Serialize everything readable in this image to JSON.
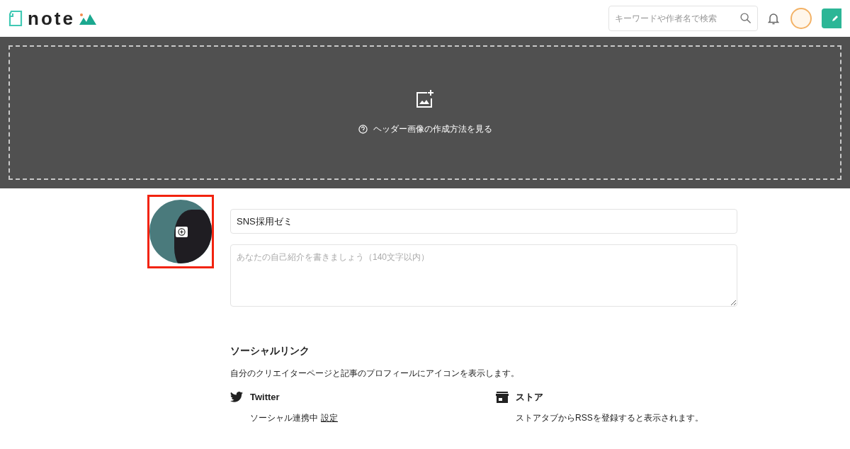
{
  "header": {
    "logo": "note",
    "search": {
      "placeholder": "キーワードや作者名で検索"
    }
  },
  "cover": {
    "help_link": "ヘッダー画像の作成方法を見る"
  },
  "profile": {
    "name": {
      "value": "SNS採用ゼミ"
    },
    "bio": {
      "placeholder": "あなたの自己紹介を書きましょう（140文字以内）"
    }
  },
  "social": {
    "title": "ソーシャルリンク",
    "description": "自分のクリエイターページと記事のプロフィールにアイコンを表示します。",
    "items": [
      {
        "kind": "twitter",
        "name": "Twitter",
        "status": "ソーシャル連携中",
        "link": "設定"
      },
      {
        "kind": "store",
        "name": "ストア",
        "status": "ストアタブからRSSを登録すると表示されます。"
      }
    ]
  }
}
